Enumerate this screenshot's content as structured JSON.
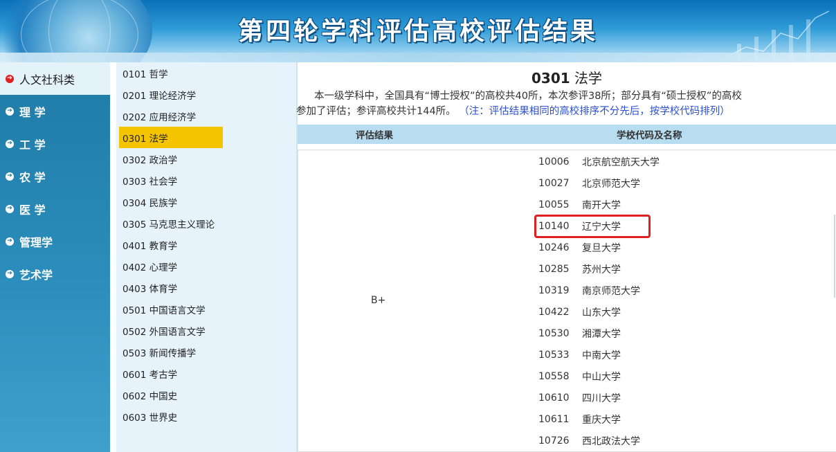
{
  "banner": {
    "title": "第四轮学科评估高校评估结果"
  },
  "categories": [
    {
      "label": "人文社科类",
      "active": true
    },
    {
      "label": "理 学",
      "active": false
    },
    {
      "label": "工 学",
      "active": false
    },
    {
      "label": "农 学",
      "active": false
    },
    {
      "label": "医 学",
      "active": false
    },
    {
      "label": "管理学",
      "active": false
    },
    {
      "label": "艺术学",
      "active": false
    }
  ],
  "subjects": [
    {
      "label": "0101 哲学",
      "active": false
    },
    {
      "label": "0201 理论经济学",
      "active": false
    },
    {
      "label": "0202 应用经济学",
      "active": false
    },
    {
      "label": "0301 法学",
      "active": true
    },
    {
      "label": "0302 政治学",
      "active": false
    },
    {
      "label": "0303 社会学",
      "active": false
    },
    {
      "label": "0304 民族学",
      "active": false
    },
    {
      "label": "0305 马克思主义理论",
      "active": false
    },
    {
      "label": "0401 教育学",
      "active": false
    },
    {
      "label": "0402 心理学",
      "active": false
    },
    {
      "label": "0403 体育学",
      "active": false
    },
    {
      "label": "0501 中国语言文学",
      "active": false
    },
    {
      "label": "0502 外国语言文学",
      "active": false
    },
    {
      "label": "0503 新闻传播学",
      "active": false
    },
    {
      "label": "0601 考古学",
      "active": false
    },
    {
      "label": "0602 中国史",
      "active": false
    },
    {
      "label": "0603 世界史",
      "active": false
    }
  ],
  "main": {
    "subject_code": "0301",
    "subject_name": "法学",
    "description_line1": "本一级学科中，全国具有“博士授权”的高校共40所，本次参评38所；部分具有“硕士授权”的高校",
    "description_line2": "参加了评估；参评高校共计144所。",
    "description_note": "（注：评估结果相同的高校排序不分先后，按学校代码排列）",
    "table_headers": {
      "result": "评估结果",
      "school": "学校代码及名称"
    },
    "grade": "B+",
    "schools": [
      {
        "code": "10006",
        "name": "北京航空航天大学"
      },
      {
        "code": "10027",
        "name": "北京师范大学"
      },
      {
        "code": "10055",
        "name": "南开大学"
      },
      {
        "code": "10140",
        "name": "辽宁大学",
        "highlighted": true
      },
      {
        "code": "10246",
        "name": "复旦大学"
      },
      {
        "code": "10285",
        "name": "苏州大学"
      },
      {
        "code": "10319",
        "name": "南京师范大学"
      },
      {
        "code": "10422",
        "name": "山东大学"
      },
      {
        "code": "10530",
        "name": "湘潭大学"
      },
      {
        "code": "10533",
        "name": "中南大学"
      },
      {
        "code": "10558",
        "name": "中山大学"
      },
      {
        "code": "10610",
        "name": "四川大学"
      },
      {
        "code": "10611",
        "name": "重庆大学"
      },
      {
        "code": "10726",
        "name": "西北政法大学"
      }
    ]
  },
  "colors": {
    "sidebar_blue": "#1f7aa6",
    "active_subject": "#f5c400",
    "highlight_red": "#e02020",
    "note_blue": "#2b4fd0"
  }
}
